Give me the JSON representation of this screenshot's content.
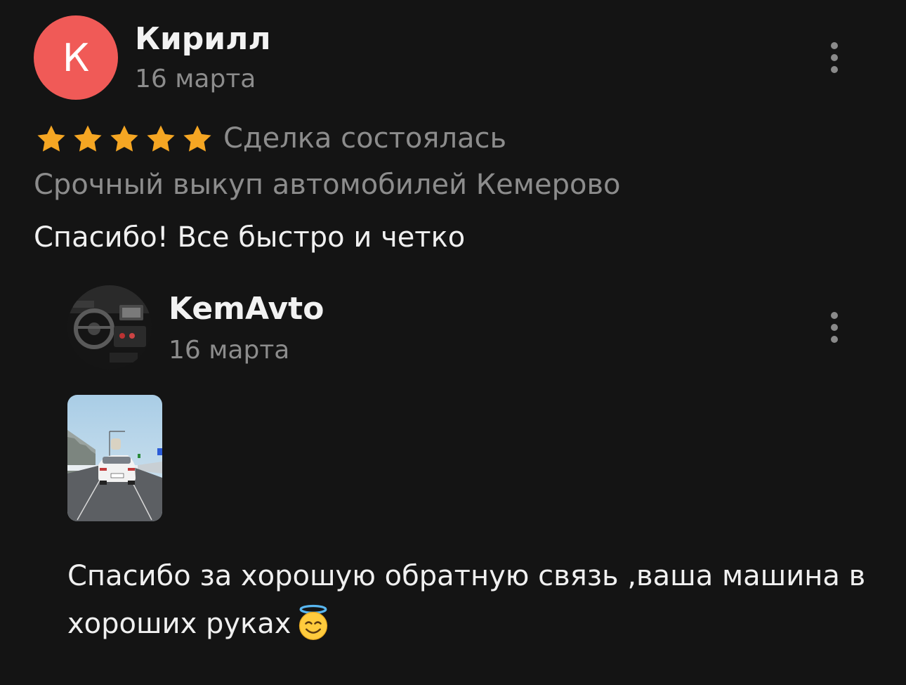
{
  "review": {
    "avatar_letter": "К",
    "author": "Кирилл",
    "date": "16 марта",
    "rating": 5,
    "status": "Сделка состоялась",
    "company": "Срочный выкуп автомобилей Кемерово",
    "text": "Спасибо! Все быстро и четко"
  },
  "reply": {
    "author": "KemAvto",
    "date": "16 марта",
    "text": "Спасибо за хорошую обратную связь ,ваша машина в хороших руках",
    "emoji": "smiling-face-with-halo"
  },
  "colors": {
    "background": "#141414",
    "avatar": "#f05a57",
    "star": "#f5a623",
    "muted_text": "#8c8c8c",
    "primary_text": "#f0f0f0"
  },
  "icons": {
    "menu": "more-vertical-icon",
    "star": "star-icon"
  }
}
